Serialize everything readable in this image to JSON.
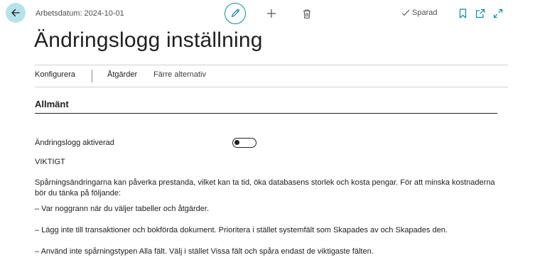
{
  "header": {
    "work_date": "Arbetsdatum: 2024-10-01",
    "saved_label": "Sparad"
  },
  "page": {
    "title": "Ändringslogg inställning"
  },
  "actions": {
    "configure": "Konfigurera",
    "actions": "Åtgärder",
    "fewer_options": "Färre alternativ"
  },
  "section": {
    "title": "Allmänt",
    "field_label": "Ändringslogg aktiverad",
    "field_value": false
  },
  "info": {
    "heading": "VIKTIGT",
    "paragraph": "Spårningsändringarna kan påverka prestanda, vilket kan ta tid, öka databasens storlek och kosta pengar. För att minska kostnaderna bör du tänka på följande:",
    "bullet1": "– Var noggrann när du väljer tabeller och åtgärder.",
    "bullet2": "– Lägg inte till transaktioner och bokförda dokument. Prioritera i stället systemfält som Skapades av och Skapades den.",
    "bullet3": "– Använd inte spårningstypen Alla fält. Välj i stället Vissa fält och spåra endast de viktigaste fälten."
  },
  "colors": {
    "accent": "#0f8ba1",
    "back_bg": "#b6e3ea"
  },
  "icons": [
    "back-arrow-icon",
    "pencil-icon",
    "plus-icon",
    "trash-icon",
    "checkmark-icon",
    "bookmark-icon",
    "open-new-window-icon",
    "expand-icon"
  ]
}
